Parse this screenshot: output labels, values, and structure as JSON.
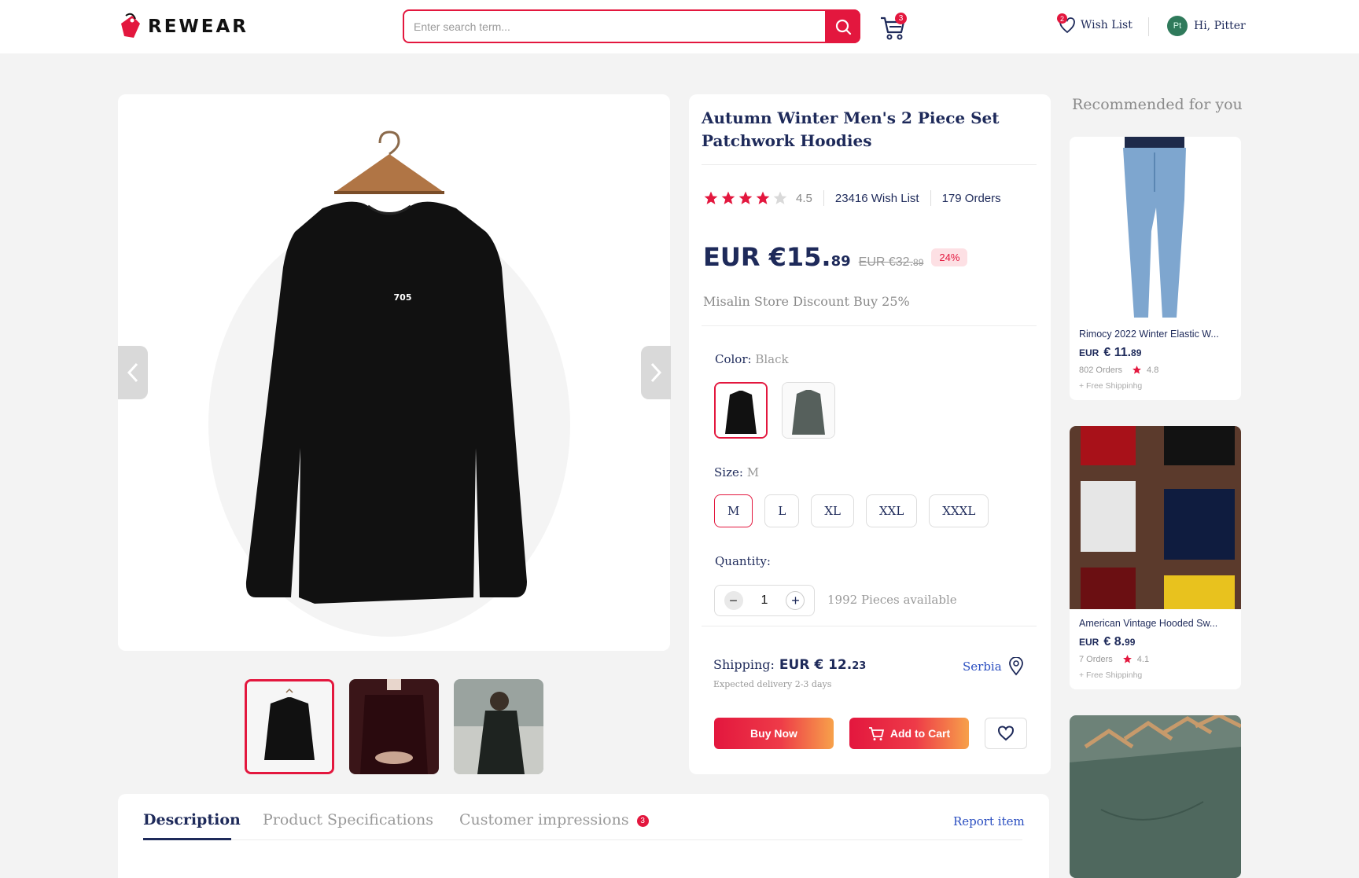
{
  "header": {
    "logo_text": "REWEAR",
    "search_placeholder": "Enter search term...",
    "cart_count": "3",
    "wishlist_count": "2",
    "wishlist_label": "Wish List",
    "avatar_initials": "Pt",
    "greeting": "Hi, Pitter"
  },
  "product": {
    "title": "Autumn Winter Men's 2 Piece Set Patchwork Hoodies",
    "rating": "4.5",
    "rating_value": 4.5,
    "wishlist": "23416 Wish List",
    "orders": "179 Orders",
    "price_main": "EUR €15.",
    "price_cents": "89",
    "old_price": "EUR €32.",
    "old_cents": "89",
    "discount": "24%",
    "store_discount": "Misalin Store Discount Buy 25%",
    "color_label": "Color:",
    "color_value": "Black",
    "size_label": "Size:",
    "size_value": "M",
    "sizes": [
      "M",
      "L",
      "XL",
      "XXL",
      "XXXL"
    ],
    "quantity_label": "Quantity:",
    "quantity": "1",
    "available": "1992 Pieces available",
    "shipping_label": "Shipping:",
    "shipping_price": "EUR  € 12.",
    "shipping_cents": "23",
    "delivery": "Expected delivery 2-3 days",
    "location": "Serbia",
    "buy_now": "Buy Now",
    "add_to_cart": "Add to Cart",
    "shirt_print": "705"
  },
  "tabs": {
    "description": "Description",
    "specs": "Product Specifications",
    "impressions": "Customer impressions",
    "impressions_count": "3",
    "report": "Report item"
  },
  "recommended": {
    "title": "Recommended for you",
    "items": [
      {
        "name": "Rimocy 2022 Winter Elastic W...",
        "currency": "EUR",
        "price": "€ 11.",
        "cents": "89",
        "orders": "802 Orders",
        "rating": "4.8",
        "shipping": "+ Free Shippinhg"
      },
      {
        "name": "American Vintage  Hooded Sw...",
        "currency": "EUR",
        "price": "€ 8.",
        "cents": "99",
        "orders": "7 Orders",
        "rating": "4.1",
        "shipping": "+ Free Shippinhg"
      }
    ]
  },
  "colors": {
    "accent": "#e3173e",
    "navy": "#1e2a5a",
    "link": "#2a4ec0"
  }
}
